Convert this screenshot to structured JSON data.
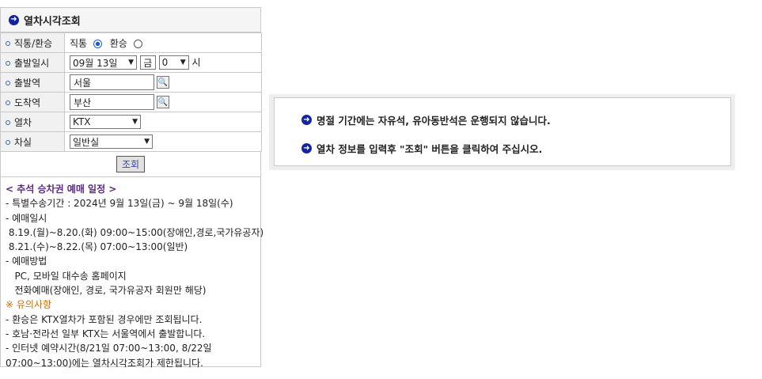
{
  "panel": {
    "title": "열차시각조회"
  },
  "form": {
    "route_type": {
      "label": "직통/환승",
      "option1": "직통",
      "option2": "환승",
      "selected": "직통"
    },
    "departure": {
      "label": "출발일시",
      "date": "09월 13일",
      "weekday": "금",
      "hour": "0",
      "hour_unit": "시"
    },
    "origin": {
      "label": "출발역",
      "value": "서울"
    },
    "destination": {
      "label": "도착역",
      "value": "부산"
    },
    "train": {
      "label": "열차",
      "value": "KTX"
    },
    "seat": {
      "label": "차실",
      "value": "일반실"
    },
    "submit_label": "조회"
  },
  "notice": {
    "heading": "< 추석 승차권 예매 일정 >",
    "lines": [
      "- 특별수송기간 : 2024년 9월 13일(금) ~ 9월 18일(수)",
      "- 예매일시",
      " 8.19.(월)~8.20.(화) 09:00~15:00(장애인,경로,국가유공자)",
      " 8.21.(수)~8.22.(목) 07:00~13:00(일반)",
      "- 예매방법",
      "   PC, 모바일 대수송 홈페이지",
      "   전화예매(장애인, 경로, 국가유공자 회원만 해당)"
    ],
    "warning": "※ 유의사항",
    "lines2": [
      "- 환승은 KTX열차가 포함된 경우에만 조회됩니다.",
      "- 호남·전라선 일부 KTX는 서울역에서 출발합니다.",
      "- 인터넷 예약시간(8/21일 07:00~13:00, 8/22일",
      "07:00~13:00)에는 열차시각조회가 제한됩니다."
    ]
  },
  "messages": {
    "line1": "명절 기간에는 자유석, 유아동반석은 운행되지 않습니다.",
    "line2": "열차 정보를 입력후 \"조회\" 버튼을 클릭하여 주십시오."
  },
  "colors": {
    "accent": "#13259e",
    "heading": "#5b2a86",
    "warning": "#d86b00"
  }
}
